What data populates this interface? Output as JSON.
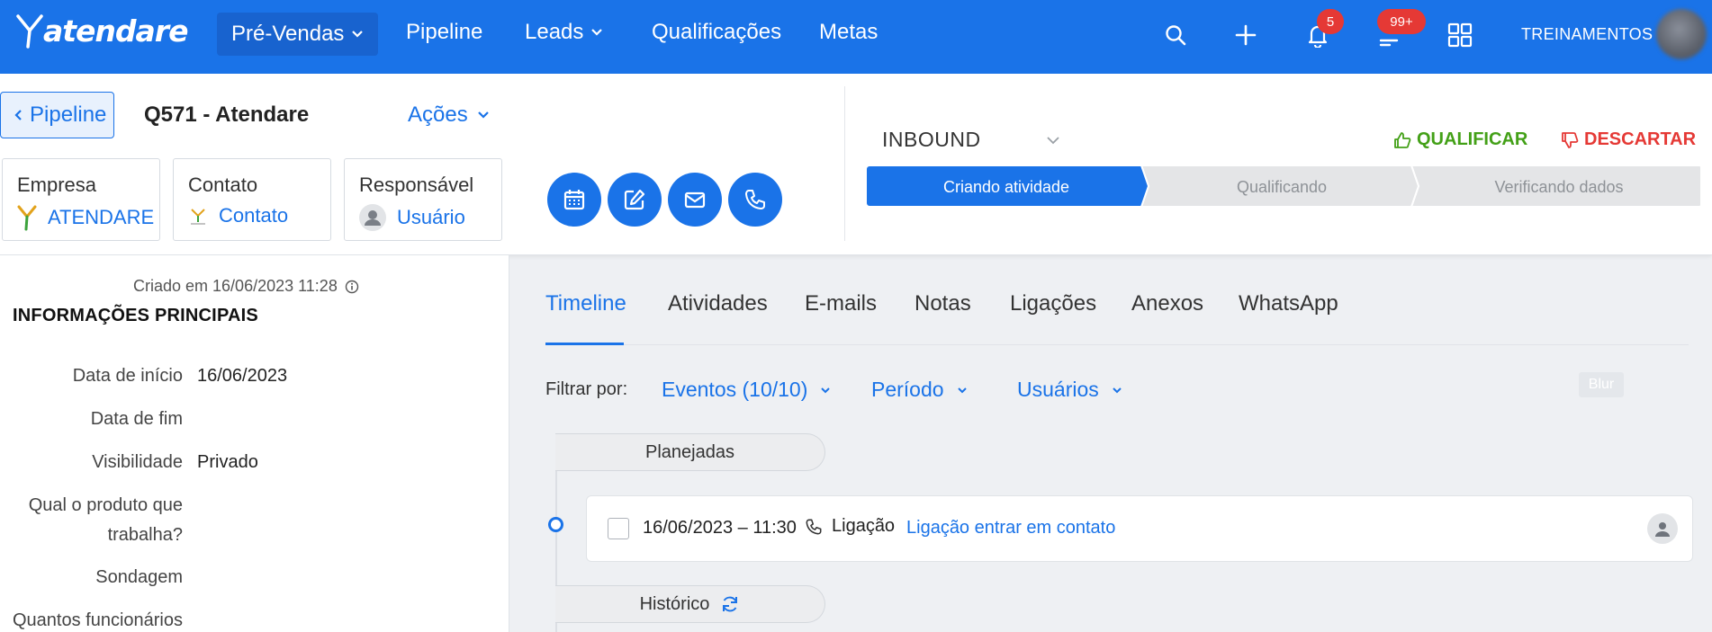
{
  "topbar": {
    "logo": "atendare",
    "nav": [
      {
        "label": "Pré-Vendas",
        "dropdown": true
      },
      {
        "label": "Pipeline",
        "dropdown": false
      },
      {
        "label": "Leads",
        "dropdown": true
      },
      {
        "label": "Qualificações",
        "dropdown": false
      },
      {
        "label": "Metas",
        "dropdown": false
      }
    ],
    "icons": [
      "search-icon",
      "plus-icon",
      "bell-icon",
      "list-icon",
      "apps-grid-icon"
    ],
    "notifications_badge": "5",
    "tasks_badge": "99+",
    "user_name": "TREINAMENTOS",
    "bg_color": "#1a73e8"
  },
  "header": {
    "back_label": "Pipeline",
    "deal_title": "Q571 - Atendare",
    "actions_label": "Ações",
    "cards": [
      {
        "title": "Empresa",
        "value": "ATENDARE"
      },
      {
        "title": "Contato",
        "value": "Contato"
      },
      {
        "title": "Responsável",
        "value": "Usuário"
      }
    ],
    "quick_actions": [
      "calendar-icon",
      "edit-icon",
      "mail-icon",
      "phone-icon"
    ],
    "origin": "INBOUND",
    "qualify_label": "QUALIFICAR",
    "discard_label": "DESCARTAR",
    "steps": [
      {
        "label": "Criando atividade",
        "active": true
      },
      {
        "label": "Qualificando",
        "active": false
      },
      {
        "label": "Verificando dados",
        "active": false
      }
    ]
  },
  "details": {
    "created": "Criado em 16/06/2023 11:28",
    "section_title": "INFORMAÇÕES PRINCIPAIS",
    "fields": [
      {
        "label": "Data de início",
        "value": "16/06/2023"
      },
      {
        "label": "Data de fim",
        "value": ""
      },
      {
        "label": "Visibilidade",
        "value": "Privado"
      },
      {
        "label_line1": "Qual o produto que",
        "label_line2": "trabalha?",
        "value": ""
      },
      {
        "label": "Sondagem",
        "value": ""
      },
      {
        "label": "Quantos funcionários",
        "value": ""
      }
    ]
  },
  "content": {
    "tabs": [
      "Timeline",
      "Atividades",
      "E-mails",
      "Notas",
      "Ligações",
      "Anexos",
      "WhatsApp"
    ],
    "active_tab": "Timeline",
    "filter_label": "Filtrar por:",
    "filters": [
      "Eventos (10/10)",
      "Período",
      "Usuários"
    ],
    "blur_label": "Blur",
    "planned_label": "Planejadas",
    "history_label": "Histórico",
    "activity": {
      "date": "16/06/2023 – 11:30",
      "type": "Ligação",
      "title": "Ligação entrar em contato"
    }
  }
}
